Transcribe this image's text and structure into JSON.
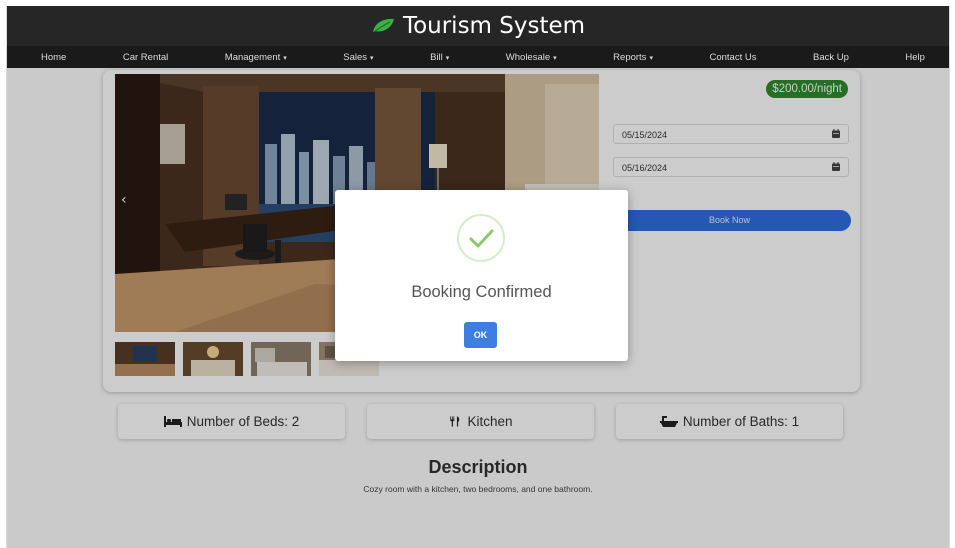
{
  "header": {
    "title": "Tourism System",
    "logo_icon": "leaf-icon",
    "logo_color": "#3cb043"
  },
  "nav": [
    {
      "label": "Home",
      "dropdown": false
    },
    {
      "label": "Car Rental",
      "dropdown": false
    },
    {
      "label": "Management",
      "dropdown": true
    },
    {
      "label": "Sales",
      "dropdown": true
    },
    {
      "label": "Bill",
      "dropdown": true
    },
    {
      "label": "Wholesale",
      "dropdown": true
    },
    {
      "label": "Reports",
      "dropdown": true
    },
    {
      "label": "Contact Us",
      "dropdown": false
    },
    {
      "label": "Back Up",
      "dropdown": false
    },
    {
      "label": "Help",
      "dropdown": false
    }
  ],
  "booking": {
    "price": "$200.00/night",
    "check_in": "05/15/2024",
    "check_out": "05/16/2024",
    "book_label": "Book Now",
    "accent_color": "#2f6fe0",
    "price_badge_color": "#2e8b2e"
  },
  "features": [
    {
      "icon": "bed-icon",
      "label": "Number of Beds: 2"
    },
    {
      "icon": "utensils-icon",
      "label": "Kitchen"
    },
    {
      "icon": "bath-icon",
      "label": "Number of Baths: 1"
    }
  ],
  "description": {
    "title": "Description",
    "text": "Cozy room with a kitchen, two bedrooms, and one bathroom."
  },
  "modal": {
    "title": "Booking Confirmed",
    "ok_label": "OK",
    "icon": "checkmark-icon",
    "check_color": "#8bc86a"
  },
  "caret": "▾"
}
